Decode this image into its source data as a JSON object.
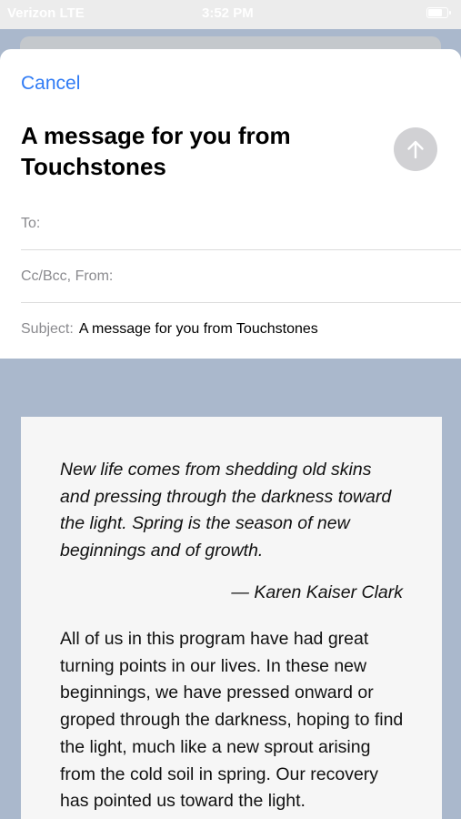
{
  "status_bar": {
    "carrier": "Verizon  LTE",
    "time": "3:52 PM",
    "battery_level": 0.75
  },
  "compose": {
    "cancel_label": "Cancel",
    "title": "A message for you from Touchstones",
    "send_icon": "arrow-up-icon",
    "fields": {
      "to_label": "To:",
      "cc_label": "Cc/Bcc, From:",
      "subject_label": "Subject:",
      "subject_value": "A message for you from Touchstones"
    }
  },
  "message": {
    "quote": "New life comes from shedding old skins and pressing through the darkness toward the light. Spring is the season of new beginnings and of growth.",
    "author": "— Karen Kaiser Clark",
    "body": "All of us in this program have had great turning points in our lives. In these new beginnings, we have pressed onward or groped through the darkness, hoping to find the light, much like a new sprout arising from the cold soil in spring. Our recovery has pointed us toward the light."
  },
  "colors": {
    "accent": "#2f7bf5",
    "background": "#aab8cc",
    "send_button": "#d1d1d4"
  }
}
